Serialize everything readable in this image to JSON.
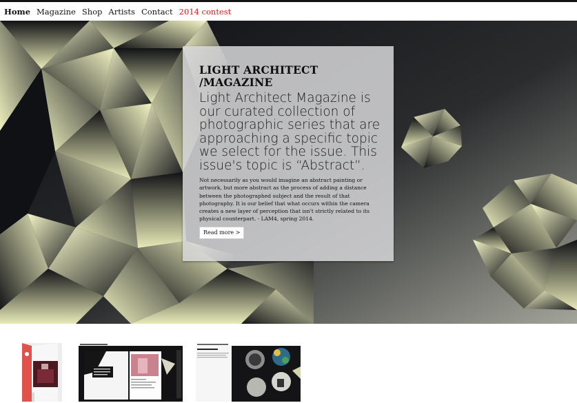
{
  "nav": {
    "items": [
      {
        "label": "Home"
      },
      {
        "label": "Magazine"
      },
      {
        "label": "Shop"
      },
      {
        "label": "Artists"
      },
      {
        "label": "Contact"
      },
      {
        "label": "2014 contest"
      }
    ]
  },
  "hero": {
    "title_line1": "LIGHT ARCHITECT",
    "title_line2": "/MAGAZINE",
    "lead": "Light Architect Magazine is our curated collection of photographic series that are approaching a specific topic we select for the issue. This issue's topic is “Abstract”.",
    "body": "Not necessarily as you would imagine an abstract painting or artwork, but more abstract as the process of adding a distance between the photographed subject and the result of that photography. It is our belief that what occurs within the camera creates a new layer of perception that isn't strictly related to its physical counterpart. - LAM4, spring 2014.",
    "read_more": "Read more >"
  },
  "colors": {
    "contest": "#d31a1a",
    "polygon_light": "#f4f5c6",
    "polygon_dark": "#111418"
  }
}
